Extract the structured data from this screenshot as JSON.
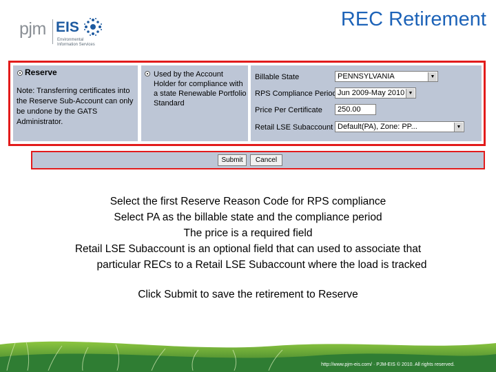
{
  "header": {
    "logo": {
      "pjm": "pjm",
      "eis": "EIS",
      "subtitle_line1": "Environmental",
      "subtitle_line2": "Information Services"
    },
    "title": "REC Retirement"
  },
  "form": {
    "reserve_label": "Reserve",
    "note": "Note: Transferring certificates into the Reserve Sub-Account can only be undone by the GATS Administrator.",
    "reason_option": "Used by the Account Holder for compliance with a state Renewable Portfolio Standard",
    "fields": {
      "billable_state": {
        "label": "Billable State",
        "value": "PENNSYLVANIA"
      },
      "rps_period": {
        "label": "RPS Compliance Period",
        "value": "Jun 2009-May 2010"
      },
      "price": {
        "label": "Price Per Certificate",
        "value": "250.00"
      },
      "lse_subaccount": {
        "label": "Retail LSE Subaccount",
        "value": "Default(PA), Zone: PP..."
      }
    }
  },
  "buttons": {
    "submit": "Submit",
    "cancel": "Cancel"
  },
  "instructions": {
    "line1": "Select the first Reserve Reason Code for RPS compliance",
    "line2": "Select PA as the billable state and the compliance period",
    "line3": "The price is a required field",
    "line4a": "Retail LSE Subaccount is an optional field that can used to associate that",
    "line4b": "particular RECs to a Retail LSE Subaccount where the load is tracked",
    "line5": "Click Submit to save the retirement to Reserve"
  },
  "footer": {
    "text": "http://www.pjm-eis.com/ · PJM-EIS © 2010. All rights reserved."
  },
  "colors": {
    "accent": "#1d63b8",
    "highlight_border": "#e21b1b",
    "form_background": "#bdc6d6",
    "footer_green": "#2a6e2a"
  }
}
